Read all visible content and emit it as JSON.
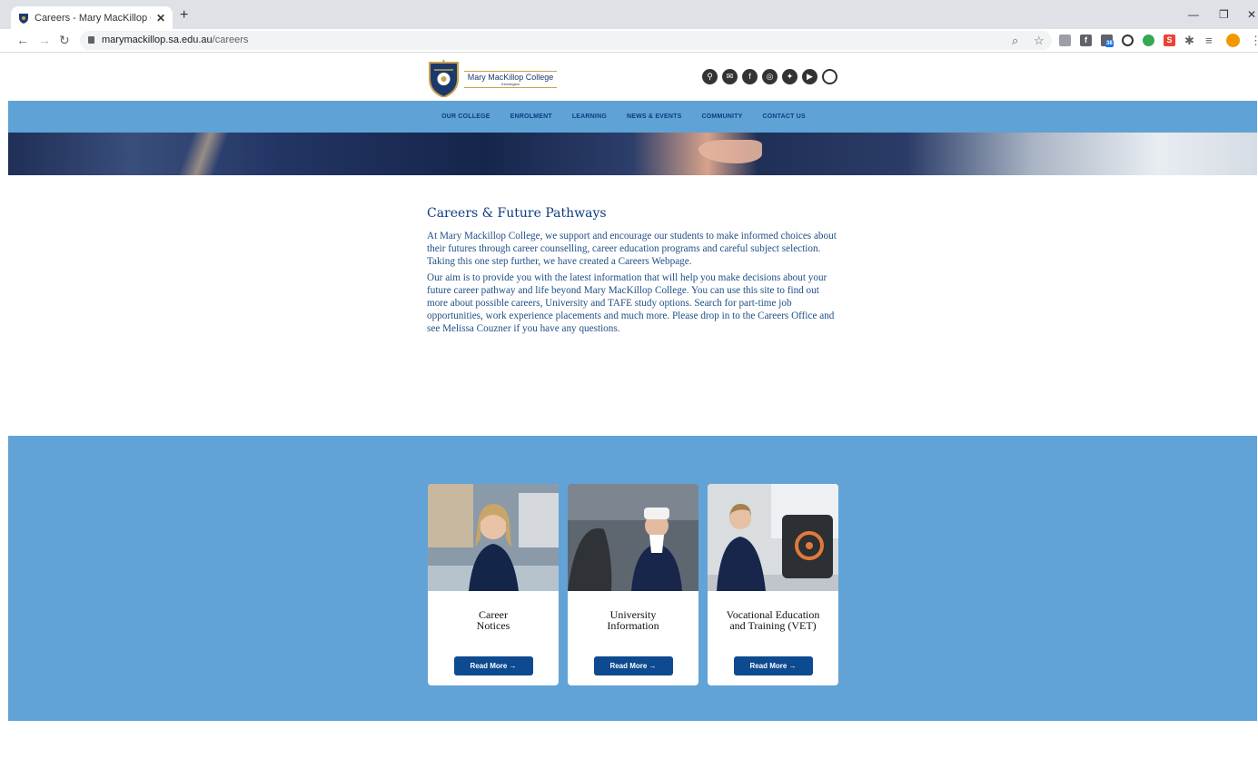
{
  "browser": {
    "tab_title": "Careers - Mary MacKillop College",
    "url_host": "marymackillop.sa.edu.au",
    "url_path": "/careers",
    "new_tab": "+",
    "tab_close": "✕",
    "ext_badge": "38"
  },
  "header": {
    "logo_name": "Mary MacKillop College",
    "logo_sub": "Kensington"
  },
  "nav": [
    "OUR COLLEGE",
    "ENROLMENT",
    "LEARNING",
    "NEWS & EVENTS",
    "COMMUNITY",
    "CONTACT US"
  ],
  "main": {
    "title": "Careers & Future Pathways",
    "paragraph1": "At Mary Mackillop College, we support and encourage our students to make informed choices about their futures through career counselling, career education programs and careful subject selection. Taking this one step further, we have created a Careers Webpage.",
    "paragraph2": "Our aim is to provide you with the latest information that will help you make decisions about your future career pathway and life beyond Mary MacKillop College. You can use this site to find out more about possible careers, University and TAFE study options. Search for part-time job opportunities, work experience placements and much more. Please drop in to the Careers Office and see Melissa Couzner if you have any questions."
  },
  "cards": [
    {
      "line1": "Career",
      "line2": "Notices",
      "button": "Read More →"
    },
    {
      "line1": "University",
      "line2": "Information",
      "button": "Read More →"
    },
    {
      "line1": "Vocational Education",
      "line2": "and Training (VET)",
      "button": "Read More →"
    }
  ],
  "colors": {
    "nav_bg": "#5ea2d6",
    "band_bg": "#61a3d7",
    "brand_blue": "#0e3d80",
    "button_bg": "#0e4a8f"
  }
}
